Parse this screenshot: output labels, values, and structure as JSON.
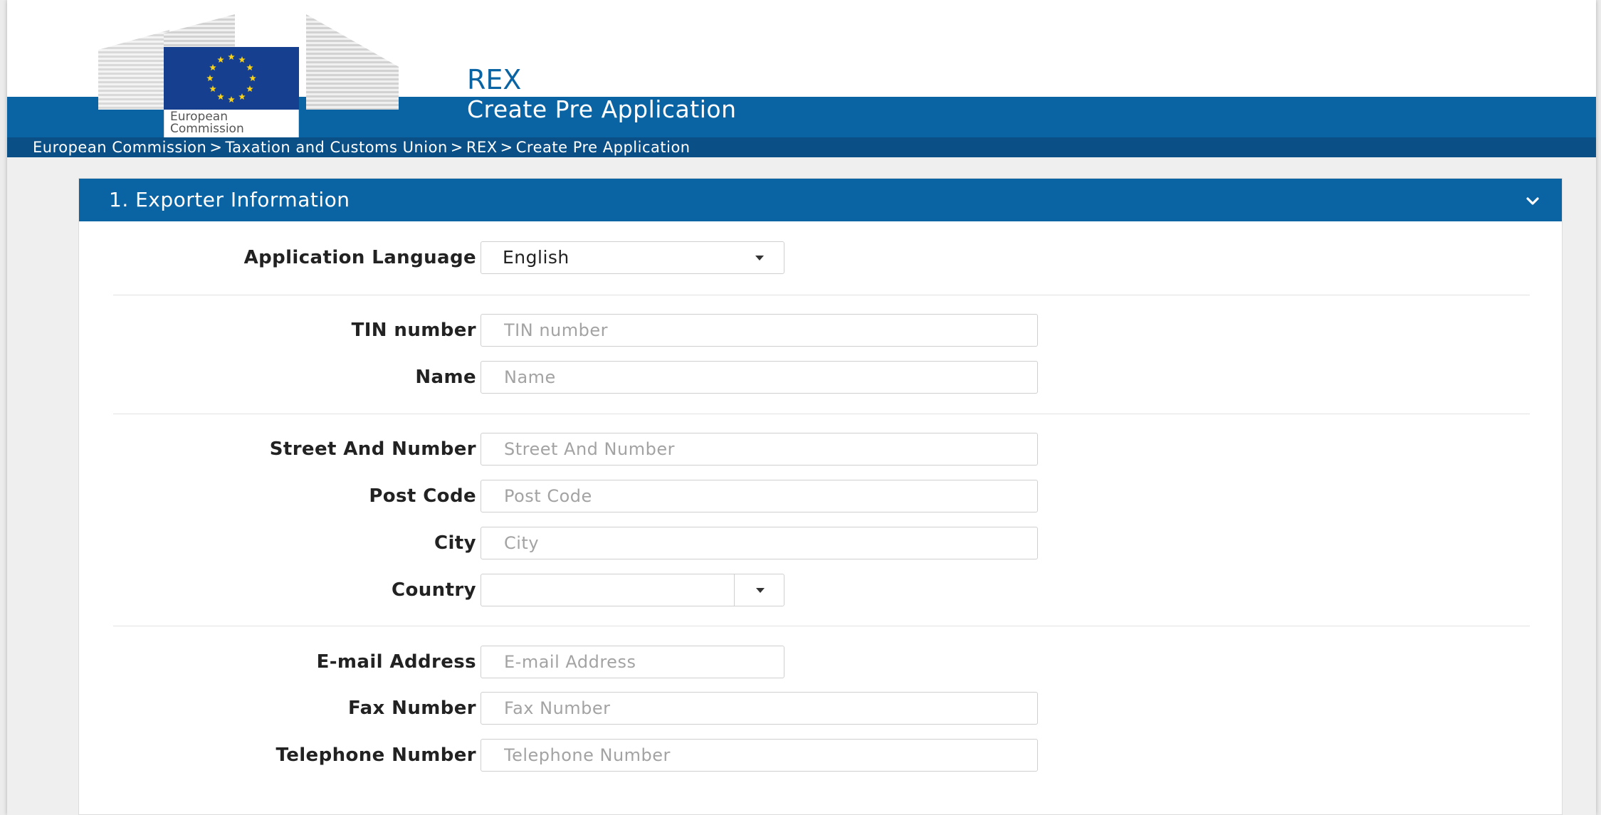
{
  "header": {
    "logo_text_line1": "European",
    "logo_text_line2": "Commission",
    "app_title": "REX",
    "page_title": "Create Pre Application"
  },
  "breadcrumb": [
    "European Commission",
    "Taxation and Customs Union",
    "REX",
    "Create Pre Application"
  ],
  "breadcrumb_separator": ">",
  "panel": {
    "title": "1. Exporter Information",
    "collapse_icon": "chevron-down-icon"
  },
  "form": {
    "application_language": {
      "label": "Application Language",
      "value": "English"
    },
    "tin_number": {
      "label": "TIN number",
      "placeholder": "TIN number",
      "value": ""
    },
    "name": {
      "label": "Name",
      "placeholder": "Name",
      "value": ""
    },
    "street": {
      "label": "Street And Number",
      "placeholder": "Street And Number",
      "value": ""
    },
    "post_code": {
      "label": "Post Code",
      "placeholder": "Post Code",
      "value": ""
    },
    "city": {
      "label": "City",
      "placeholder": "City",
      "value": ""
    },
    "country": {
      "label": "Country",
      "value": ""
    },
    "email": {
      "label": "E-mail Address",
      "placeholder": "E-mail Address",
      "value": ""
    },
    "fax": {
      "label": "Fax Number",
      "placeholder": "Fax Number",
      "value": ""
    },
    "telephone": {
      "label": "Telephone Number",
      "placeholder": "Telephone Number",
      "value": ""
    }
  },
  "colors": {
    "brand_blue": "#0a64a4",
    "breadcrumb_blue": "#0a4f86",
    "flag_blue": "#163f8f",
    "star_yellow": "#f7d117"
  }
}
